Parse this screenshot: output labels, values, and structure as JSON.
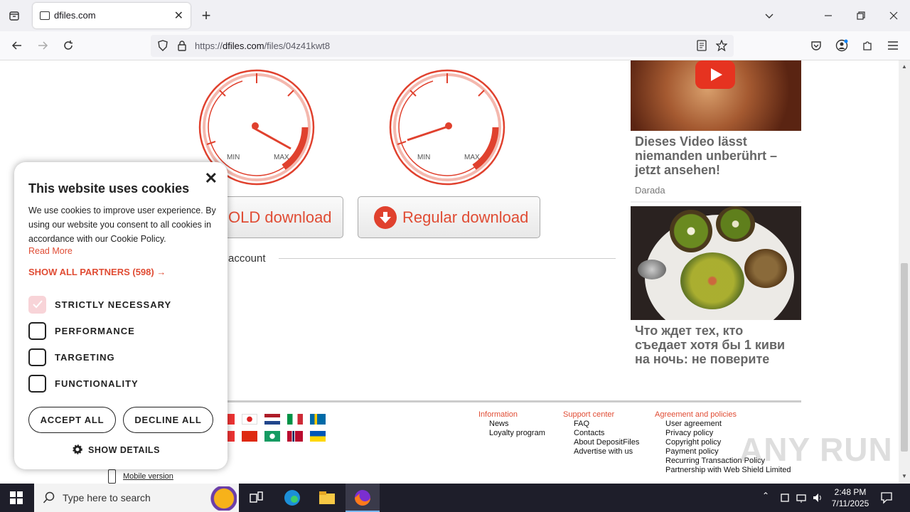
{
  "browser": {
    "tab_title": "dfiles.com",
    "url_prefix": "https://",
    "url_domain": "dfiles.com",
    "url_path": "/files/04z41kwt8"
  },
  "page": {
    "gauges": [
      {
        "min_label": "MIN",
        "max_label": "MAX"
      },
      {
        "min_label": "MIN",
        "max_label": "MAX"
      }
    ],
    "gold_download_label": "OLD download",
    "regular_download_label": "Regular download",
    "account_text": "account",
    "ads": [
      {
        "title": "Dieses Video lässt niemanden unberührt – jetzt ansehen!",
        "source": "Darada"
      },
      {
        "title": "Что ждет тех, кто съедает хотя бы 1 киви на ночь: не поверите"
      }
    ],
    "footer": {
      "columns": [
        {
          "heading": "Information",
          "items": [
            "News",
            "Loyalty program"
          ]
        },
        {
          "heading": "Support center",
          "items": [
            "FAQ",
            "Contacts",
            "About DepositFiles",
            "Advertise with us"
          ]
        },
        {
          "heading": "Agreement and policies",
          "items": [
            "User agreement",
            "Privacy policy",
            "Copyright policy",
            "Payment policy",
            "Recurring Transaction Policy",
            "Partnership with Web Shield Limited"
          ]
        }
      ],
      "mobile_version": "Mobile version"
    },
    "watermark": "ANY RUN"
  },
  "cookie_dialog": {
    "title": "This website uses cookies",
    "body": "We use cookies to improve user experience. By using our website you consent to all cookies in accordance with our Cookie Policy.",
    "read_more": "Read More",
    "show_partners": "SHOW ALL PARTNERS (598) →",
    "options": [
      {
        "label": "STRICTLY NECESSARY",
        "checked": true
      },
      {
        "label": "PERFORMANCE",
        "checked": false
      },
      {
        "label": "TARGETING",
        "checked": false
      },
      {
        "label": "FUNCTIONALITY",
        "checked": false
      }
    ],
    "accept_all": "ACCEPT ALL",
    "decline_all": "DECLINE ALL",
    "show_details": "SHOW DETAILS"
  },
  "taskbar": {
    "search_placeholder": "Type here to search",
    "time": "2:48 PM",
    "date": "7/11/2025"
  },
  "colors": {
    "accent": "#e04c34",
    "gauge_red": "#e0412e"
  }
}
